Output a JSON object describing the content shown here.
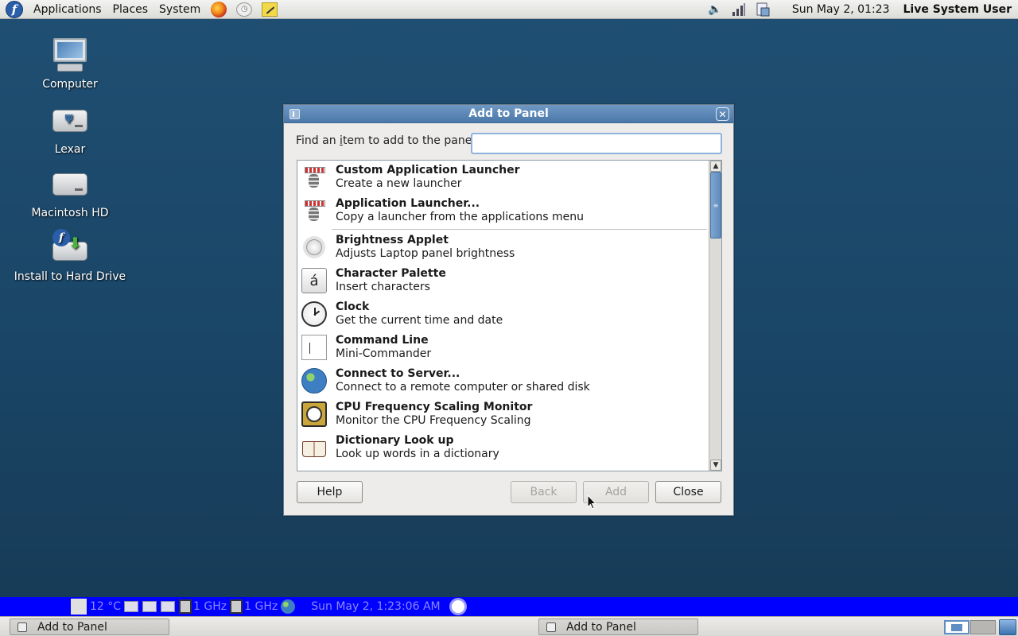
{
  "top_panel": {
    "menus": [
      "Applications",
      "Places",
      "System"
    ],
    "clock": "Sun May  2, 01:23",
    "user": "Live System User"
  },
  "desktop_icons": [
    {
      "label": "Computer"
    },
    {
      "label": "Lexar"
    },
    {
      "label": "Macintosh HD"
    },
    {
      "label": "Install to Hard Drive"
    }
  ],
  "dialog": {
    "title": "Add to Panel",
    "find_label_pre": "Find an ",
    "find_label_ul": "i",
    "find_label_post": "tem to add to the panel:",
    "search_value": "",
    "items": [
      {
        "name": "Custom Application Launcher",
        "desc": "Create a new launcher",
        "icon": "launcher-icon"
      },
      {
        "name": "Application Launcher...",
        "desc": "Copy a launcher from the applications menu",
        "icon": "launcher-icon"
      },
      {
        "name": "Brightness Applet",
        "desc": "Adjusts Laptop panel brightness",
        "icon": "brightness-icon"
      },
      {
        "name": "Character Palette",
        "desc": "Insert characters",
        "icon": "character-palette-icon"
      },
      {
        "name": "Clock",
        "desc": "Get the current time and date",
        "icon": "clock-icon"
      },
      {
        "name": "Command Line",
        "desc": "Mini-Commander",
        "icon": "command-line-icon"
      },
      {
        "name": "Connect to Server...",
        "desc": "Connect to a remote computer or shared disk",
        "icon": "globe-icon"
      },
      {
        "name": "CPU Frequency Scaling Monitor",
        "desc": "Monitor the CPU Frequency Scaling",
        "icon": "cpu-icon"
      },
      {
        "name": "Dictionary Look up",
        "desc": "Look up words in a dictionary",
        "icon": "dictionary-icon"
      }
    ],
    "char_glyph": "á",
    "buttons": {
      "help": "Help",
      "back": "Back",
      "add": "Add",
      "close": "Close"
    }
  },
  "blue_bar": {
    "temperature": "12 °C",
    "cpu1": "1 GHz",
    "cpu2": "1 GHz",
    "datetime": "Sun May  2,  1:23:06 AM"
  },
  "taskbar": {
    "tasks": [
      "Add to Panel",
      "Add to Panel"
    ]
  }
}
